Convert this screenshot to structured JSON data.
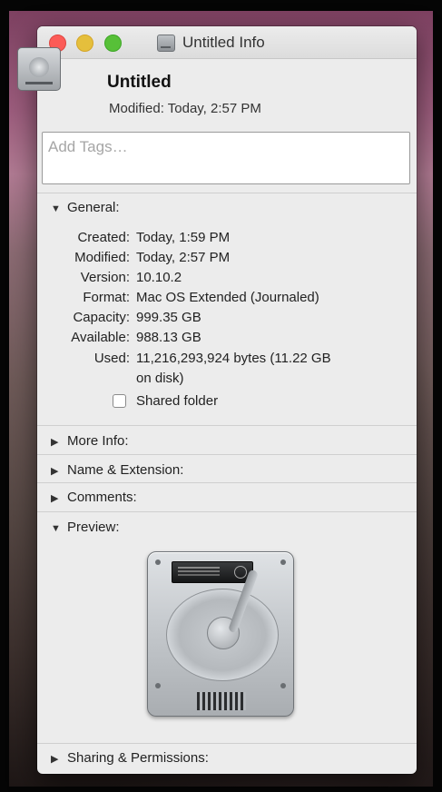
{
  "window": {
    "title": "Untitled Info",
    "title_icon": "hard-drive-icon"
  },
  "header": {
    "name": "Untitled",
    "modified": "Modified: Today, 2:57 PM",
    "icon": "hard-drive-icon"
  },
  "tags": {
    "placeholder": "Add Tags…"
  },
  "sections": {
    "general": "General:",
    "more_info": "More Info:",
    "name_extension": "Name & Extension:",
    "comments": "Comments:",
    "preview": "Preview:",
    "sharing": "Sharing & Permissions:"
  },
  "general": {
    "rows": [
      {
        "label": "Created:",
        "value": "Today, 1:59 PM"
      },
      {
        "label": "Modified:",
        "value": "Today, 2:57 PM"
      },
      {
        "label": "Version:",
        "value": "10.10.2"
      },
      {
        "label": "Format:",
        "value": "Mac OS Extended (Journaled)"
      },
      {
        "label": "Capacity:",
        "value": "999.35 GB"
      },
      {
        "label": "Available:",
        "value": "988.13 GB"
      },
      {
        "label": "Used:",
        "value": "11,216,293,924 bytes (11.22 GB"
      }
    ],
    "used_cont": "on disk)",
    "shared_folder_label": "Shared folder",
    "shared_folder_checked": false
  },
  "icons": {
    "expanded": "▼",
    "collapsed": "▶"
  },
  "colors": {
    "close": "#fc5b57",
    "minimize": "#e5bf3c",
    "zoom": "#57c038"
  }
}
